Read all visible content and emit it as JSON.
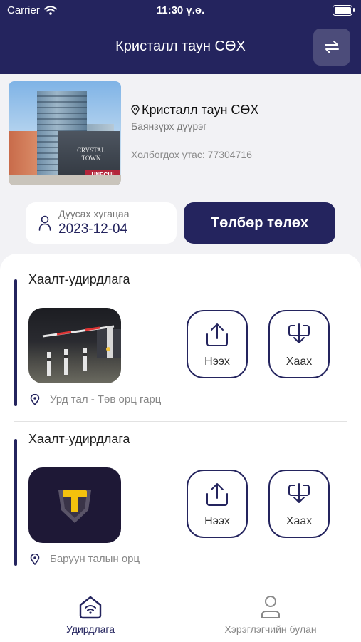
{
  "status_bar": {
    "carrier": "Carrier",
    "time": "11:30 ү.ө."
  },
  "header": {
    "title": "Кристалл таун СӨХ"
  },
  "property": {
    "name": "Кристалл таун СӨХ",
    "district": "Баянзүрх дүүрэг",
    "phone": "Холбогдох утас: 77304716",
    "photo_sign": "CRYSTAL TOWN",
    "photo_watermark": "UNEGUI"
  },
  "due": {
    "label": "Дуусах хугацаа",
    "date": "2023-12-04"
  },
  "pay_button": "Төлбөр төлөх",
  "gates": [
    {
      "title": "Хаалт-удирдлага",
      "open_label": "Нээх",
      "close_label": "Хаах",
      "location": "Урд тал - Төв орц гарц"
    },
    {
      "title": "Хаалт-удирдлага",
      "open_label": "Нээх",
      "close_label": "Хаах",
      "location": "Баруун талын орц"
    }
  ],
  "nav": {
    "control": "Удирдлага",
    "user": "Хэрэглэгчийн булан"
  },
  "colors": {
    "primary": "#24245e",
    "background": "#f2f2f5",
    "muted": "#888888"
  },
  "icons": [
    "wifi-icon",
    "battery-icon",
    "swap-icon",
    "map-pin-icon",
    "user-icon",
    "upload-icon",
    "download-icon",
    "home-wifi-icon",
    "user-profile-icon"
  ]
}
